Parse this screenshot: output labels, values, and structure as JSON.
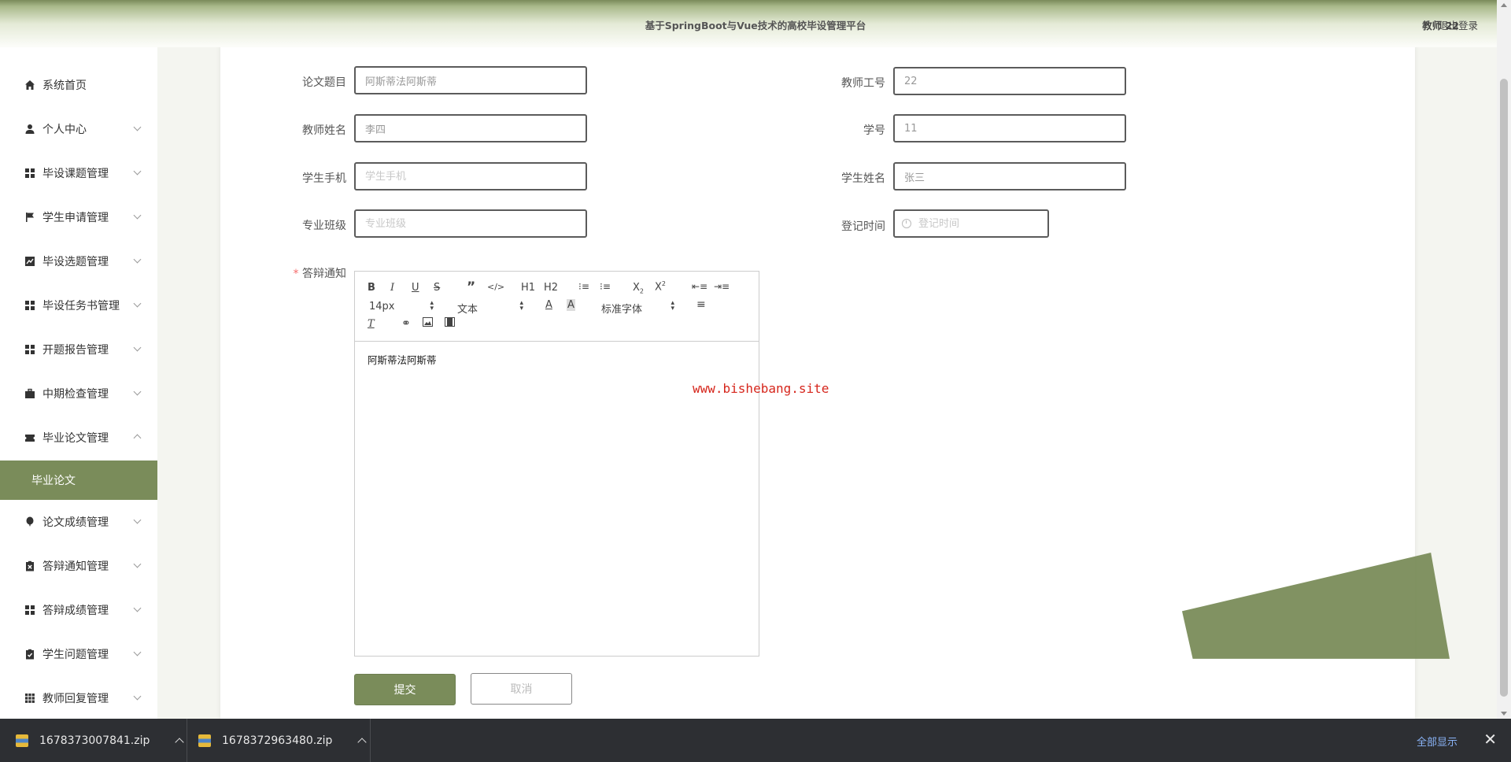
{
  "header": {
    "title": "基于SpringBoot与Vue技术的高校毕设管理平台",
    "user": "教师 22",
    "logout": "退出登录"
  },
  "sidebar": {
    "items": [
      {
        "label": "系统首页",
        "icon": "home-icon"
      },
      {
        "label": "个人中心",
        "icon": "user-icon"
      },
      {
        "label": "毕设课题管理",
        "icon": "grid-icon"
      },
      {
        "label": "学生申请管理",
        "icon": "flag-icon"
      },
      {
        "label": "毕设选题管理",
        "icon": "chart-icon"
      },
      {
        "label": "毕设任务书管理",
        "icon": "grid-icon"
      },
      {
        "label": "开题报告管理",
        "icon": "grid-icon"
      },
      {
        "label": "中期检查管理",
        "icon": "briefcase-icon"
      },
      {
        "label": "毕业论文管理",
        "icon": "ticket-icon"
      },
      {
        "label": "论文成绩管理",
        "icon": "balloon-icon"
      },
      {
        "label": "答辩通知管理",
        "icon": "clipboard-x-icon"
      },
      {
        "label": "答辩成绩管理",
        "icon": "grid-icon"
      },
      {
        "label": "学生问题管理",
        "icon": "clipboard-check-icon"
      },
      {
        "label": "教师回复管理",
        "icon": "grid-3x3-icon"
      }
    ],
    "active_sub": "毕业论文"
  },
  "form": {
    "thesis_title": {
      "label": "论文题目",
      "value": "阿斯蒂法阿斯蒂"
    },
    "teacher_id": {
      "label": "教师工号",
      "value": "22"
    },
    "teacher_name": {
      "label": "教师姓名",
      "value": "李四"
    },
    "student_id": {
      "label": "学号",
      "value": "11"
    },
    "student_phone": {
      "label": "学生手机",
      "placeholder": "学生手机"
    },
    "student_name": {
      "label": "学生姓名",
      "value": "张三"
    },
    "major_class": {
      "label": "专业班级",
      "placeholder": "专业班级"
    },
    "register_time": {
      "label": "登记时间",
      "placeholder": "登记时间"
    },
    "defense_notice": {
      "label": "答辩通知",
      "required": "*",
      "content": "阿斯蒂法阿斯蒂"
    }
  },
  "editor_toolbar": {
    "font_size": "14px",
    "format": "文本",
    "font_family": "标准字体",
    "h1": "H1",
    "h2": "H2"
  },
  "watermark": "www.bishebang.site",
  "buttons": {
    "submit": "提交",
    "cancel": "取消"
  },
  "downloads": {
    "files": [
      "1678373007841.zip",
      "1678372963480.zip"
    ],
    "show_all": "全部显示"
  },
  "colors": {
    "accent": "#7a8c5a",
    "required": "#f56c6c",
    "watermark": "#d6261c"
  }
}
